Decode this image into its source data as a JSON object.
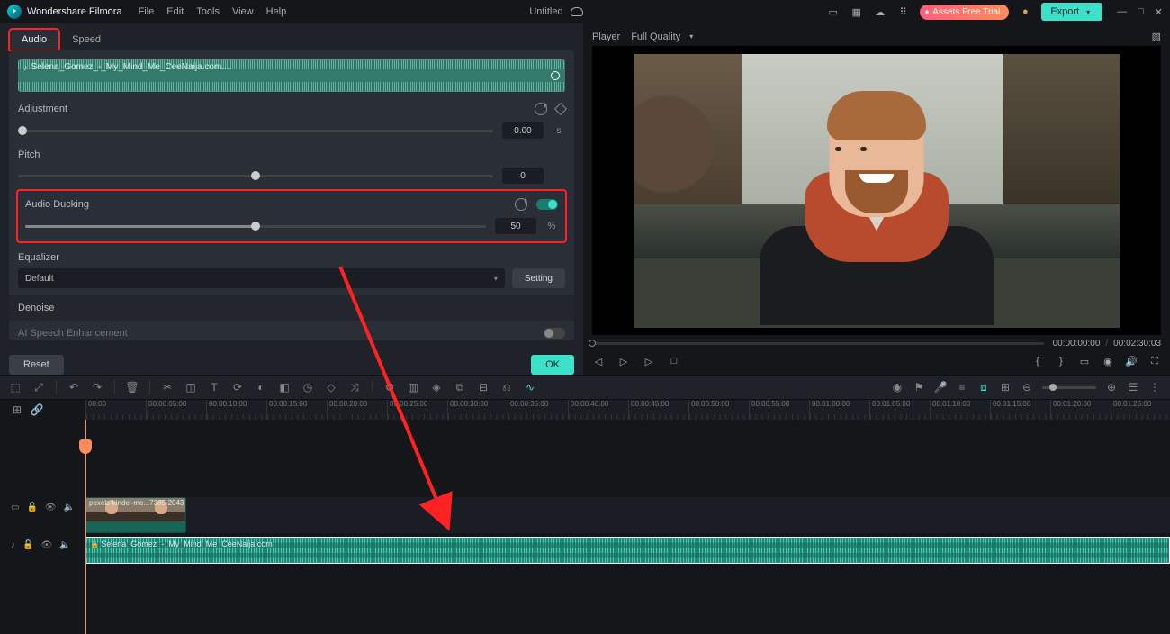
{
  "app": {
    "name": "Wondershare Filmora",
    "title": "Untitled"
  },
  "menu": [
    "File",
    "Edit",
    "Tools",
    "View",
    "Help"
  ],
  "badge": "Assets Free Trial",
  "export": "Export",
  "tabs": {
    "audio": "Audio",
    "speed": "Speed"
  },
  "clip": {
    "name": "Selena_Gomez_-_My_Mind_Me_CeeNaija.com...."
  },
  "panel": {
    "adjustment": {
      "label": "Adjustment",
      "value": "0.00",
      "unit": "s",
      "pos": 1
    },
    "pitch": {
      "label": "Pitch",
      "value": "0",
      "pos": 50
    },
    "ducking": {
      "label": "Audio Ducking",
      "value": "50",
      "unit": "%",
      "pos": 50
    },
    "equalizer": {
      "label": "Equalizer",
      "preset": "Default",
      "setting": "Setting"
    },
    "denoise": {
      "label": "Denoise"
    },
    "ai": {
      "label": "AI Speech Enhancement"
    }
  },
  "buttons": {
    "reset": "Reset",
    "ok": "OK"
  },
  "player": {
    "label": "Player",
    "quality": "Full Quality",
    "current": "00:00:00:00",
    "total": "00:02:30:03"
  },
  "ruler": [
    "00:00",
    "00:00:05:00",
    "00:00:10:00",
    "00:00:15:00",
    "00:00:20:00",
    "00:00:25:00",
    "00:00:30:00",
    "00:00:35:00",
    "00:00:40:00",
    "00:00:45:00",
    "00:00:50:00",
    "00:00:55:00",
    "00:01:00:00",
    "00:01:05:00",
    "00:01:10:00",
    "00:01:15:00",
    "00:01:20:00",
    "00:01:25:00"
  ],
  "timeline": {
    "video_label": "pexels-kindel-me...7385-2043",
    "audio_label": "Selena_Gomez_-_My_Mind_Me_CeeNaija.com"
  }
}
